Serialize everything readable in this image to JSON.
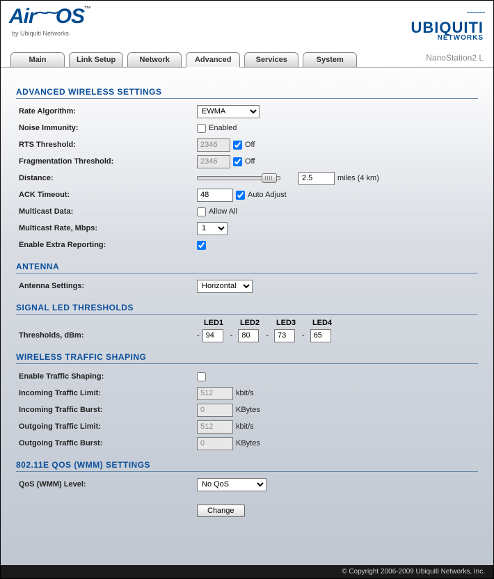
{
  "brand": {
    "air": "Air",
    "os": "OS",
    "byline": "by Ubiquiti Networks",
    "ubnt": "UBIQUITI",
    "ubnt_sub": "NETWORKS"
  },
  "tabs": [
    "Main",
    "Link Setup",
    "Network",
    "Advanced",
    "Services",
    "System"
  ],
  "active_tab": 3,
  "device": "NanoStation2 L",
  "sections": {
    "aws": "ADVANCED WIRELESS SETTINGS",
    "ant": "ANTENNA",
    "led": "SIGNAL LED THRESHOLDS",
    "wts": "WIRELESS TRAFFIC SHAPING",
    "qos": "802.11E QOS (WMM) SETTINGS"
  },
  "labels": {
    "rate_alg": "Rate Algorithm:",
    "noise": "Noise Immunity:",
    "rts": "RTS Threshold:",
    "frag": "Fragmentation Threshold:",
    "dist": "Distance:",
    "ack": "ACK Timeout:",
    "mcast": "Multicast Data:",
    "mrate": "Multicast Rate, Mbps:",
    "extra": "Enable Extra Reporting:",
    "antset": "Antenna Settings:",
    "thr": "Thresholds, dBm:",
    "ets": "Enable Traffic Shaping:",
    "itl": "Incoming Traffic Limit:",
    "itb": "Incoming Traffic Burst:",
    "otl": "Outgoing Traffic Limit:",
    "otb": "Outgoing Traffic Burst:",
    "qoslvl": "QoS (WMM) Level:"
  },
  "values": {
    "rate_alg": "EWMA",
    "noise_label": "Enabled",
    "noise_checked": false,
    "rts_val": "2346",
    "rts_off_checked": true,
    "off": "Off",
    "frag_val": "2346",
    "frag_off_checked": true,
    "dist_val": "2.5",
    "dist_unit": "miles (4 km)",
    "ack_val": "48",
    "ack_auto": true,
    "ack_auto_label": "Auto Adjust",
    "mcast_checked": false,
    "mcast_label": "Allow All",
    "mrate": "1",
    "extra_checked": true,
    "antenna": "Horizontal",
    "led_heads": [
      "LED1",
      "LED2",
      "LED3",
      "LED4"
    ],
    "led_vals": [
      "94",
      "80",
      "73",
      "65"
    ],
    "ets_checked": false,
    "itl": "512",
    "kbits": "kbit/s",
    "itb": "0",
    "kbytes": "KBytes",
    "otl": "512",
    "otb": "0",
    "qos": "No QoS",
    "change": "Change"
  },
  "footer": "© Copyright 2006-2009 Ubiquiti Networks, Inc."
}
